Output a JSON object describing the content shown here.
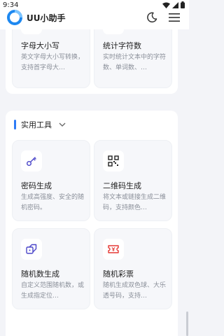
{
  "status_bar": {
    "time": "9:34"
  },
  "app": {
    "title": "UU小助手"
  },
  "top_cards": [
    {
      "title": "字母大小写",
      "description": "英文字母大小写转换，支持首字母大…",
      "icon": "text-case-icon"
    },
    {
      "title": "统计字符数",
      "description": "实时统计文本中的字符数、单词数、…",
      "icon": "count-icon"
    }
  ],
  "section": {
    "title": "实用工具",
    "cards": [
      {
        "title": "密码生成",
        "description": "生成高强度、安全的随机密码。",
        "icon": "key-icon",
        "icon_color": "#4b46c9"
      },
      {
        "title": "二维码生成",
        "description": "将文本或链接生成二维码，支持颜色…",
        "icon": "qr-code-icon",
        "icon_color": "#222222"
      },
      {
        "title": "随机数生成",
        "description": "自定义范围随机数，或生成指定位…",
        "icon": "dice-icon",
        "icon_color": "#4b46c9"
      },
      {
        "title": "随机彩票",
        "description": "随机生成双色球、大乐透号码，支持…",
        "icon": "ticket-icon",
        "icon_color": "#e53935"
      }
    ]
  },
  "colors": {
    "accent": "#2d7bf6",
    "background": "#f3f4f8",
    "card": "#f6f7fa"
  }
}
